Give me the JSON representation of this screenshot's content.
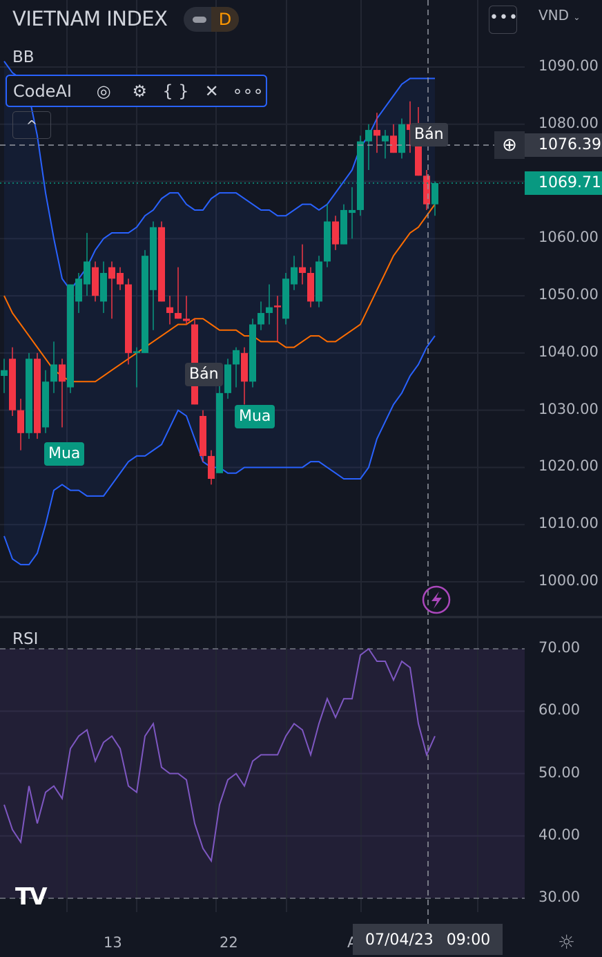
{
  "header": {
    "title": "VIETNAM INDEX",
    "interval": "D",
    "more": "•••",
    "currency": "VND"
  },
  "indicators": {
    "bb_label": "BB",
    "rsi_label": "RSI"
  },
  "toolbar": {
    "name": "CodeAI",
    "eye": "◎",
    "gear": "⚙",
    "braces": "{ }",
    "close": "✕",
    "more": "∘∘∘",
    "collapse": "^"
  },
  "price_axis": {
    "labels": [
      "1090.00",
      "1080.00",
      "1060.00",
      "1050.00",
      "1040.00",
      "1030.00",
      "1020.00",
      "1010.00",
      "1000.00"
    ],
    "crosshair_price": "1076.39",
    "last_price": "1069.71",
    "rsi_labels": [
      "70.00",
      "60.00",
      "50.00",
      "40.00",
      "30.00"
    ]
  },
  "markers": [
    {
      "text": "Mua",
      "type": "buy"
    },
    {
      "text": "Mua",
      "type": "buy"
    },
    {
      "text": "Bán",
      "type": "sell"
    },
    {
      "text": "Bán",
      "type": "sell"
    }
  ],
  "time_axis": {
    "labels": [
      "13",
      "22",
      "A"
    ],
    "crosshair": "07/04/23 09:00"
  },
  "colors": {
    "up": "#089981",
    "down": "#f23645",
    "bb_band": "#2962ff",
    "bb_basis": "#ff6d00",
    "rsi": "#7e57c2",
    "last": "#089981"
  },
  "chart_data": {
    "type": "candlestick",
    "price_range": [
      1000,
      1090
    ],
    "rsi_range": [
      30,
      70
    ],
    "candles": [
      [
        1036,
        1039,
        1033,
        1037
      ],
      [
        1039,
        1041,
        1029,
        1030
      ],
      [
        1030,
        1032,
        1023,
        1026
      ],
      [
        1026,
        1040,
        1025,
        1039
      ],
      [
        1039,
        1040,
        1025,
        1026
      ],
      [
        1027,
        1037,
        1026,
        1035
      ],
      [
        1035,
        1042,
        1033,
        1038
      ],
      [
        1038,
        1039,
        1027,
        1035
      ],
      [
        1034,
        1052,
        1033,
        1052
      ],
      [
        1049,
        1054,
        1047,
        1053
      ],
      [
        1052,
        1061,
        1050,
        1056
      ],
      [
        1055,
        1056,
        1049,
        1050
      ],
      [
        1049,
        1056,
        1047,
        1054
      ],
      [
        1055,
        1056,
        1046,
        1053
      ],
      [
        1054,
        1055,
        1051,
        1052
      ],
      [
        1052,
        1053,
        1038,
        1040
      ],
      [
        1040,
        1041,
        1034,
        1040.3
      ],
      [
        1040,
        1058,
        1040,
        1057
      ],
      [
        1051,
        1063,
        1044,
        1062
      ],
      [
        1062,
        1063,
        1049,
        1049
      ],
      [
        1048,
        1050,
        1045,
        1047
      ],
      [
        1047,
        1055,
        1046,
        1046
      ],
      [
        1046,
        1050,
        1045,
        1045.6
      ],
      [
        1045,
        1046,
        1031,
        1031
      ],
      [
        1029,
        1030,
        1021,
        1022
      ],
      [
        1022,
        1023,
        1017,
        1018
      ],
      [
        1019,
        1035,
        1019,
        1033
      ],
      [
        1033,
        1039,
        1032,
        1038
      ],
      [
        1038,
        1041,
        1034,
        1040.5
      ],
      [
        1040,
        1041,
        1031,
        1035
      ],
      [
        1035,
        1046,
        1034,
        1045
      ],
      [
        1045,
        1049,
        1044,
        1047
      ],
      [
        1047,
        1052,
        1045,
        1048
      ],
      [
        1048.3,
        1050,
        1042,
        1048
      ],
      [
        1046,
        1054,
        1045,
        1053
      ],
      [
        1052,
        1057,
        1051,
        1055
      ],
      [
        1055,
        1059,
        1052,
        1054
      ],
      [
        1054,
        1055,
        1048,
        1049
      ],
      [
        1049,
        1057,
        1048,
        1056
      ],
      [
        1056,
        1066,
        1055,
        1063
      ],
      [
        1063,
        1064,
        1058,
        1059
      ],
      [
        1059,
        1066,
        1059,
        1065
      ],
      [
        1064.5,
        1069,
        1060,
        1065
      ],
      [
        1065,
        1078,
        1064,
        1077
      ],
      [
        1077,
        1080,
        1072,
        1079
      ],
      [
        1079,
        1082,
        1075,
        1078
      ],
      [
        1077,
        1079,
        1074,
        1078
      ],
      [
        1078,
        1080,
        1075,
        1075
      ],
      [
        1075,
        1081,
        1074,
        1080
      ],
      [
        1080,
        1084,
        1075,
        1079
      ],
      [
        1078,
        1083,
        1071,
        1071
      ],
      [
        1071,
        1072,
        1065,
        1066
      ],
      [
        1066,
        1070,
        1064,
        1069.71
      ]
    ],
    "bb_upper": [
      1091,
      1089,
      1088,
      1085,
      1078,
      1068,
      1060,
      1053,
      1051,
      1053,
      1055,
      1058,
      1060,
      1061,
      1061,
      1061,
      1062,
      1064,
      1065,
      1067,
      1068,
      1068,
      1066,
      1065,
      1065,
      1067,
      1068,
      1068,
      1068,
      1067,
      1066,
      1065,
      1065,
      1064,
      1064,
      1065,
      1066,
      1066,
      1065,
      1066,
      1068,
      1070,
      1072,
      1076,
      1078,
      1081,
      1083,
      1085,
      1087,
      1088,
      1088,
      1088,
      1088
    ],
    "bb_basis": [
      1050,
      1047,
      1045,
      1043,
      1041,
      1039,
      1037,
      1036,
      1035,
      1035,
      1035,
      1035,
      1036,
      1037,
      1038,
      1039,
      1040,
      1041,
      1042,
      1043,
      1044,
      1045,
      1045,
      1046,
      1046,
      1045,
      1044,
      1044,
      1044,
      1043,
      1043,
      1042,
      1042,
      1042,
      1041,
      1041,
      1042,
      1043,
      1043,
      1042,
      1042,
      1043,
      1044,
      1045,
      1048,
      1051,
      1054,
      1057,
      1059,
      1061,
      1062,
      1064,
      1066
    ],
    "bb_lower": [
      1008,
      1004,
      1003,
      1003,
      1005,
      1010,
      1016,
      1017,
      1016,
      1016,
      1015,
      1015,
      1015,
      1017,
      1019,
      1021,
      1022,
      1022,
      1023,
      1024,
      1027,
      1030,
      1029,
      1025,
      1021,
      1020,
      1020,
      1019,
      1019,
      1020,
      1020,
      1020,
      1020,
      1020,
      1020,
      1020,
      1020,
      1021,
      1021,
      1020,
      1019,
      1018,
      1018,
      1018,
      1020,
      1025,
      1028,
      1031,
      1033,
      1036,
      1038,
      1041,
      1043
    ],
    "rsi": [
      45,
      41,
      39,
      48,
      42,
      47,
      48,
      46,
      54,
      56,
      57,
      52,
      55,
      56,
      54,
      48,
      47,
      56,
      58,
      51,
      50,
      50,
      49,
      42,
      38,
      36,
      45,
      49,
      50,
      48,
      52,
      53,
      53,
      53,
      56,
      58,
      57,
      53,
      58,
      62,
      59,
      62,
      62,
      69,
      70,
      68,
      68,
      65,
      68,
      67,
      58,
      53,
      56
    ]
  }
}
